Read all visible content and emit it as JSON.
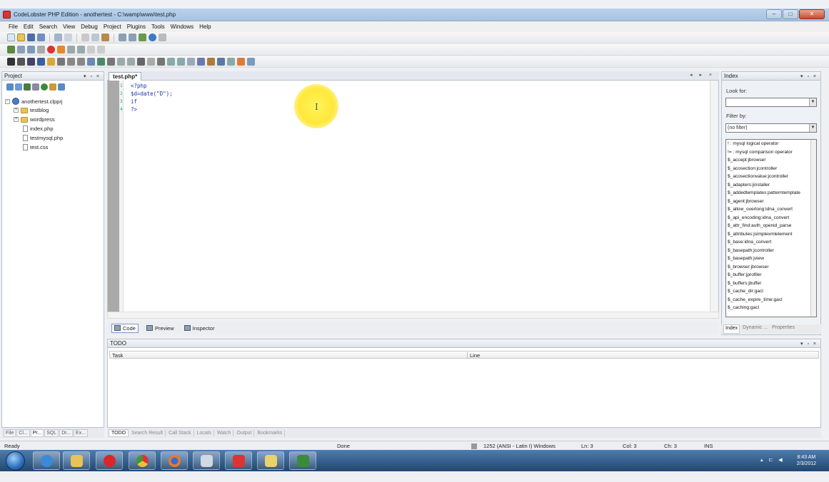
{
  "window": {
    "title": "CodeLobster PHP Edition - anothertest - C:\\wamp\\www\\test.php"
  },
  "menu": [
    "File",
    "Edit",
    "Search",
    "View",
    "Debug",
    "Project",
    "Plugins",
    "Tools",
    "Windows",
    "Help"
  ],
  "project_panel": {
    "title": "Project",
    "tree": [
      {
        "label": "anothertest.clpprj",
        "kind": "project"
      },
      {
        "label": "testblog",
        "kind": "folder"
      },
      {
        "label": "wordpress",
        "kind": "folder"
      },
      {
        "label": "index.php",
        "kind": "file"
      },
      {
        "label": "testmysql.php",
        "kind": "file"
      },
      {
        "label": "test.css",
        "kind": "file"
      }
    ],
    "bottom_tabs": [
      "File",
      "Cl...",
      "Pr...",
      "SQL",
      "Dr...",
      "Ex..."
    ]
  },
  "editor": {
    "tab": "test.php*",
    "lines": [
      {
        "num": "1",
        "code": "<?php"
      },
      {
        "num": "2",
        "code": "$d=date(\"D\");"
      },
      {
        "num": "3",
        "code": "if"
      },
      {
        "num": "4",
        "code": "?>"
      }
    ],
    "view_tabs": [
      "Code",
      "Preview",
      "Inspector"
    ]
  },
  "index_panel": {
    "title": "Index",
    "look_for_label": "Look for:",
    "look_for_value": "",
    "filter_label": "Filter by:",
    "filter_value": "(no filter)",
    "items": [
      "! : mysql logical operator",
      "!= : mysql comparison operator",
      "$_accept:jbrowser",
      "$_acosection:jcontroller",
      "$_acosectionvalue:jcontroller",
      "$_adapters:jinstaller",
      "$_addedtemplates:patterntemplate",
      "$_agent:jbrowser",
      "$_allow_overlong:idna_convert",
      "$_api_encoding:idna_convert",
      "$_attr_find:auth_openid_parse",
      "$_attributes:jsimplexmlelement",
      "$_base:idna_convert",
      "$_basepath:jcontroller",
      "$_basepath:jview",
      "$_browser:jbrowser",
      "$_buffer:jprofiler",
      "$_buffers:jbuffer",
      "$_cache_dir:gacl",
      "$_cache_expire_time:gacl",
      "$_caching:gacl"
    ],
    "tabs": [
      "Index",
      "Dynamic ...",
      "Properties"
    ]
  },
  "todo_panel": {
    "title": "TODO",
    "columns": [
      "Task",
      "Line"
    ],
    "tabs": [
      "TODO",
      "Search Result",
      "Call Stack",
      "Locals",
      "Watch",
      "Output",
      "Bookmarks"
    ]
  },
  "statusbar": {
    "ready": "Ready",
    "done": "Done",
    "encoding": "1252 (ANSI - Latin I) Windows",
    "line": "Ln: 3",
    "col": "Col: 3",
    "ch": "Ch: 3",
    "mode": "INS"
  },
  "taskbar": {
    "time": "8:43 AM",
    "date": "2/3/2012"
  },
  "colors": {
    "accent": "#1a2fa8",
    "gutter": "#a9a9a9",
    "highlight": "#ffe83a"
  }
}
